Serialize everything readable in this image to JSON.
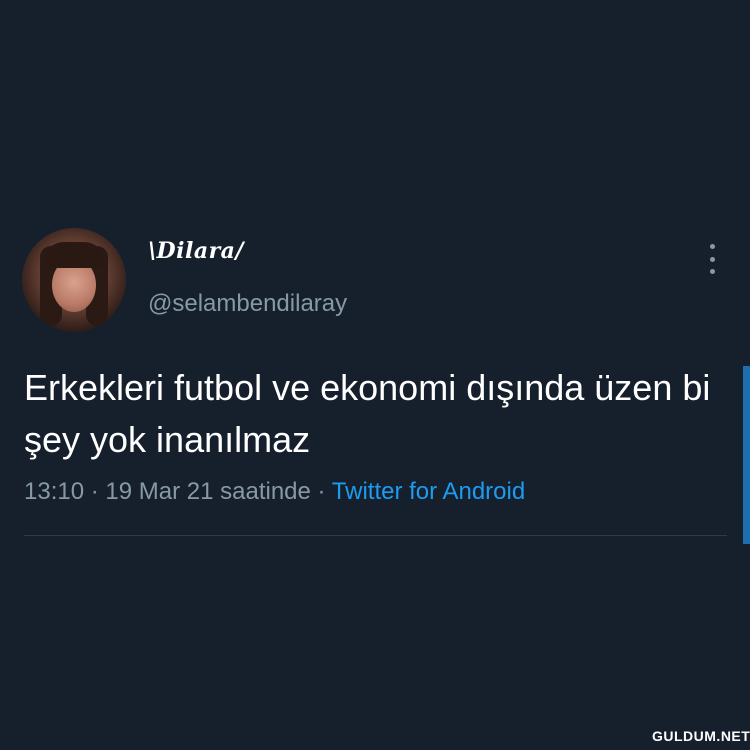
{
  "tweet": {
    "display_name": "\\Dilara/",
    "handle": "@selambendilaray",
    "text": "Erkekleri futbol ve ekonomi dışında üzen bi şey yok inanılmaz",
    "time": "13:10",
    "date": "19 Mar 21 saatinde",
    "separator": "·",
    "source": "Twitter for Android"
  },
  "icons": {
    "more": "more-vertical-icon",
    "avatar": "profile-avatar"
  },
  "colors": {
    "background": "#16202c",
    "primary_text": "#ffffff",
    "secondary_text": "#8899a6",
    "link": "#1d9bf0",
    "divider": "#2f3b47"
  },
  "watermark": "GULDUM.NET"
}
